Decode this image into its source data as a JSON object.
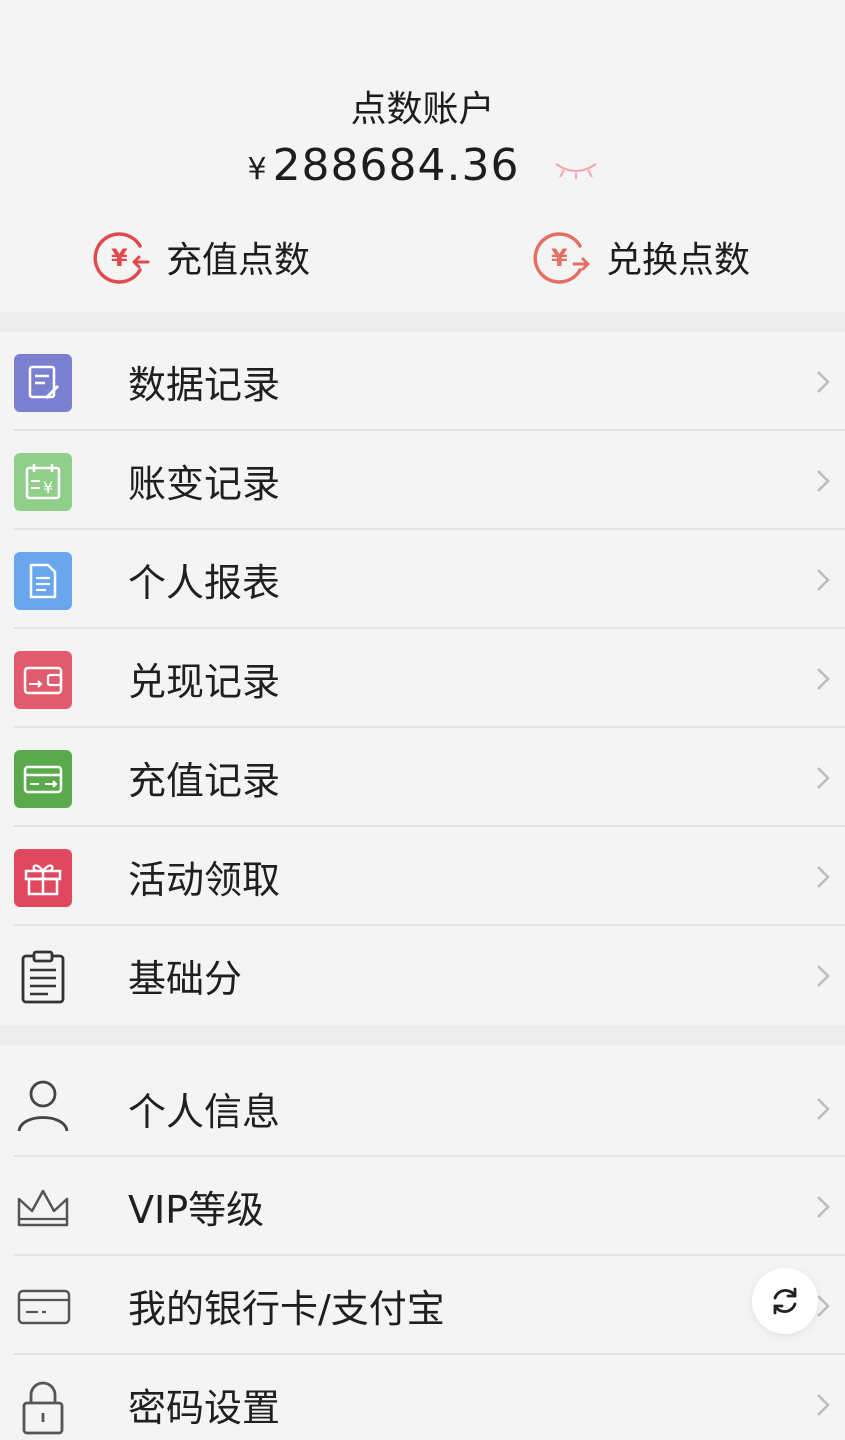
{
  "account": {
    "title": "点数账户",
    "currency": "¥",
    "balance": "288684.36",
    "actions": [
      {
        "label": "充值点数",
        "icon": "yen-recharge-icon"
      },
      {
        "label": "兑换点数",
        "icon": "yen-exchange-icon"
      }
    ]
  },
  "menu_group_1": [
    {
      "label": "数据记录",
      "icon": "data-record-icon",
      "color": "#7b7fcf"
    },
    {
      "label": "账变记录",
      "icon": "calendar-yen-icon",
      "color": "#8fcf8a"
    },
    {
      "label": "个人报表",
      "icon": "document-icon",
      "color": "#6aa6ee"
    },
    {
      "label": "兑现记录",
      "icon": "wallet-icon",
      "color": "#e25a6e"
    },
    {
      "label": "充值记录",
      "icon": "card-icon",
      "color": "#5aaa4c"
    },
    {
      "label": "活动领取",
      "icon": "gift-icon",
      "color": "#e0485f"
    },
    {
      "label": "基础分",
      "icon": "clipboard-icon",
      "color": "#333333"
    }
  ],
  "menu_group_2": [
    {
      "label": "个人信息",
      "icon": "user-icon"
    },
    {
      "label": "VIP等级",
      "icon": "crown-icon"
    },
    {
      "label": "我的银行卡/支付宝",
      "icon": "bank-card-icon"
    },
    {
      "label": "密码设置",
      "icon": "lock-icon"
    }
  ],
  "colors": {
    "accent": "#e04a4f",
    "background": "#f4f4f4",
    "divider": "#e3e3e3"
  }
}
